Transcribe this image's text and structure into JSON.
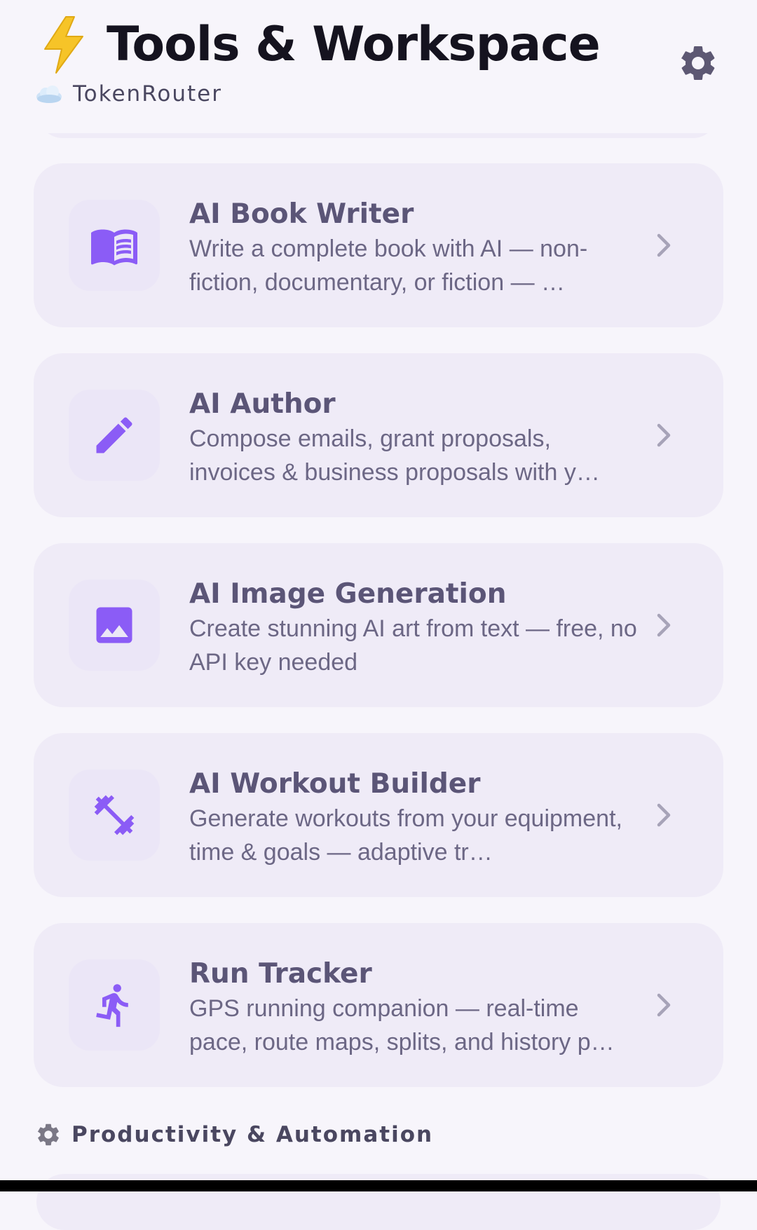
{
  "header": {
    "title": "Tools & Workspace",
    "title_icon": "lightning-bolt-emoji",
    "settings_icon": "gear-icon",
    "subtitle": "TokenRouter",
    "subtitle_icon": "cloud-emoji"
  },
  "cards": [
    {
      "title": "AI Book Writer",
      "description": "Write a complete book with AI — non-fiction, documentary, or fiction — …",
      "icon": "menu-book-icon"
    },
    {
      "title": "AI Author",
      "description": "Compose emails, grant proposals, invoices & business proposals with y…",
      "icon": "pencil-icon"
    },
    {
      "title": "AI Image Generation",
      "description": "Create stunning AI art from text — free, no API key needed",
      "icon": "image-icon"
    },
    {
      "title": "AI Workout Builder",
      "description": "Generate workouts from your equipment, time & goals — adaptive tr…",
      "icon": "dumbbell-icon"
    },
    {
      "title": "Run Tracker",
      "description": "GPS running companion — real-time pace, route maps, splits, and history p…",
      "icon": "running-icon"
    }
  ],
  "section": {
    "label": "Productivity & Automation",
    "icon": "gear-emoji"
  },
  "colors": {
    "background": "#f7f5fb",
    "card": "#efebf7",
    "accent": "#8b5cf6",
    "title_text": "#15131f",
    "card_title": "#5b5577",
    "card_desc": "#6c6785",
    "chevron": "#a7a3b8"
  }
}
